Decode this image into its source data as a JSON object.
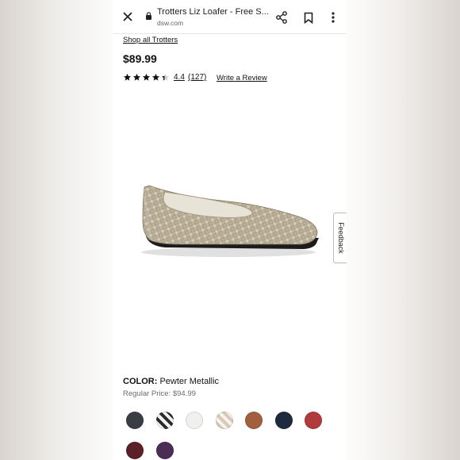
{
  "browser": {
    "tab_title": "Trotters Liz Loafer - Free S...",
    "url": "dsw.com"
  },
  "product": {
    "brand_link": "Shop all Trotters",
    "price": "$89.99",
    "rating": "4.4",
    "review_count": "(127)",
    "write_review": "Write a Review",
    "stars_filled": 4,
    "stars_partial": 0.4,
    "color_label": "COLOR:",
    "color_value": "Pewter Metallic",
    "regular_price": "Regular Price: $94.99"
  },
  "feedback": {
    "label": "Feedback"
  },
  "swatches": [
    {
      "name": "black",
      "color": "#3a3d44"
    },
    {
      "name": "black-white",
      "color": "#8a8a8a"
    },
    {
      "name": "white",
      "color": "#f0f0ee"
    },
    {
      "name": "white-tan",
      "color": "#e8ddd3"
    },
    {
      "name": "brown",
      "color": "#a25f3d"
    },
    {
      "name": "navy",
      "color": "#1f2a3f"
    },
    {
      "name": "red",
      "color": "#b13a3a"
    },
    {
      "name": "dark-red",
      "color": "#5c1f27"
    },
    {
      "name": "purple",
      "color": "#4a2c55"
    }
  ],
  "colors": {
    "text": "#111111",
    "muted": "#6b6b6b"
  }
}
